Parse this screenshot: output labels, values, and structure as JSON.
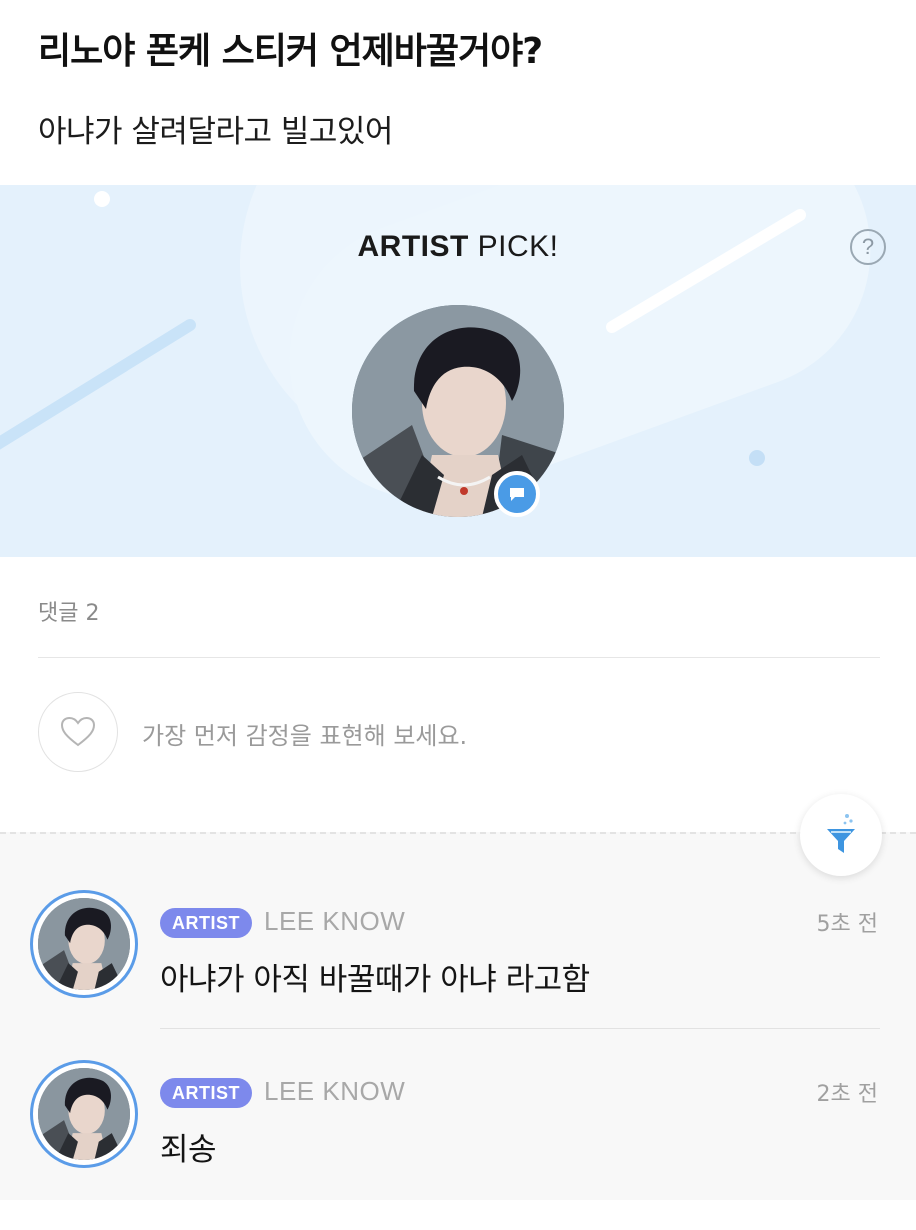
{
  "post": {
    "title": "리노야 폰케 스티커 언제바꿀거야?",
    "body": "아냐가 살려달라고 빌고있어"
  },
  "artist_pick": {
    "title_bold": "ARTIST",
    "title_regular": " PICK!",
    "help_icon": "?",
    "icons": [
      "help-icon",
      "chat-bubble-icon"
    ]
  },
  "comments_section": {
    "count_label": "댓글 2",
    "reaction_prompt": "가장 먼저 감정을 표현해 보세요.",
    "icons": [
      "heart-icon",
      "filter-icon"
    ]
  },
  "comments": [
    {
      "badge": "ARTIST",
      "author": "LEE KNOW",
      "time": "5초 전",
      "text": "아냐가 아직 바꿀때가 아냐 라고함"
    },
    {
      "badge": "ARTIST",
      "author": "LEE KNOW",
      "time": "2초 전",
      "text": "죄송"
    }
  ],
  "colors": {
    "banner_bg": "#e4f1fc",
    "artist_badge": "#7d89ec",
    "avatar_ring": "#5b9ce8",
    "chat_badge": "#4a9be6"
  }
}
